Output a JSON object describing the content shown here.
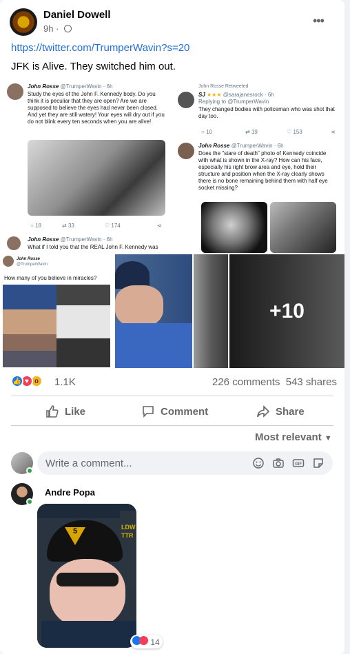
{
  "post": {
    "author": "Daniel Dowell",
    "time": "9h",
    "link": "https://twitter.com/TrumperWavin?s=20",
    "text": "JFK is Alive. They switched him out."
  },
  "media": {
    "tweet1": {
      "name": "John Rosse",
      "meta": "@TrumperWavin · 6h",
      "body": "Study the eyes of the John F. Kennedy body. Do you think it is peculiar that they are open? Are we are supposed to believe the eyes had never been closed. And yet they are still watery! Your eyes will dry out if you do not blink every ten seconds when you are alive!",
      "replies": "18",
      "retweets": "33",
      "likes": "174"
    },
    "tweet2": {
      "retweeted": "John Rosse Retweeted",
      "name": "SJ",
      "meta": "@sarajanesrock · 6h",
      "replying": "Replying to @TrumperWavin",
      "body": "They changed bodies with policeman who was shot that day too.",
      "replies": "10",
      "retweets": "19",
      "likes": "153"
    },
    "tweet3": {
      "name": "John Rosse",
      "meta": "@TrumperWavin · 6h",
      "body": "Does the \"stare of death\" photo of Kennedy coincide with what is shown in the X-ray? How can his face, especially his right brow area and eye, hold their structure and position when the X-ray clearly shows there is no bone remaining behind them with half eye socket missing?"
    },
    "tweet4": {
      "name": "John Rosse",
      "meta": "@TrumperWavin · 6h",
      "body": "What if I told you that the REAL John F. Kennedy was"
    },
    "tweet5": {
      "name": "John Rosse",
      "meta": "@TrumperWavin",
      "body": "How many of you believe in miracles?"
    },
    "more_count": "+10"
  },
  "engagement": {
    "reactions": "1.1K",
    "comments": "226 comments",
    "shares": "543 shares"
  },
  "actions": {
    "like": "Like",
    "comment": "Comment",
    "share": "Share"
  },
  "comments": {
    "sort": "Most relevant",
    "placeholder": "Write a comment...",
    "first": {
      "name": "Andre Popa",
      "reactions": "14"
    }
  }
}
